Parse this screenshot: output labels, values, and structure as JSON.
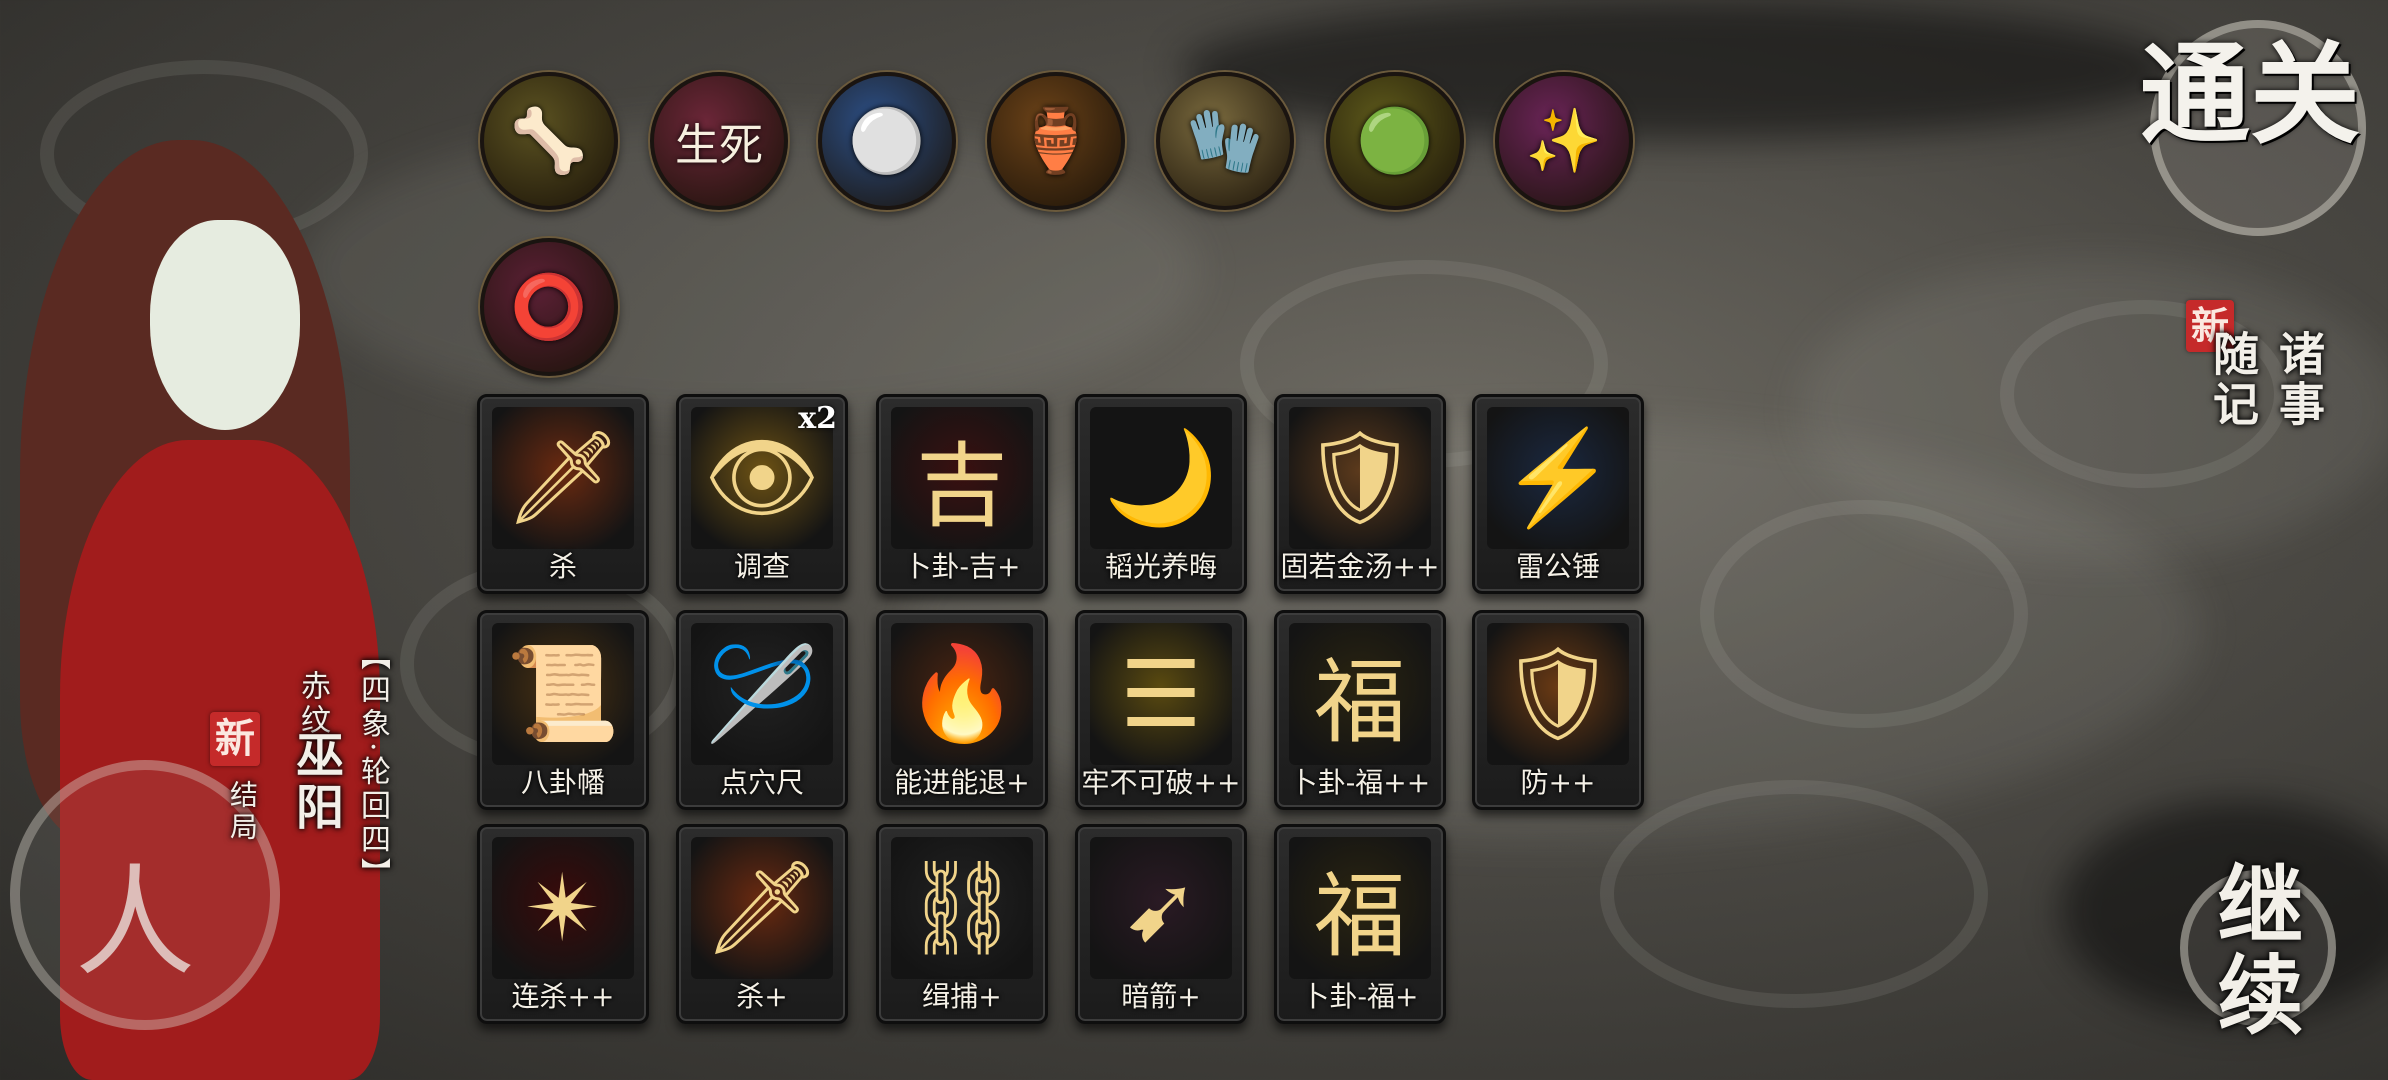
{
  "relics": [
    {
      "icon": "horn-icon",
      "glyph": "🦴",
      "bg": "#5b5221"
    },
    {
      "icon": "brush-life-death-icon",
      "glyph": "生死",
      "bg": "#6b2638"
    },
    {
      "icon": "pearls-icon",
      "glyph": "⚪",
      "bg": "#2c4f86"
    },
    {
      "icon": "gold-cup-icon",
      "glyph": "🏺",
      "bg": "#6b4218"
    },
    {
      "icon": "bracer-icon",
      "glyph": "🧤",
      "bg": "#7a6a3e"
    },
    {
      "icon": "green-jade-icon",
      "glyph": "🟢",
      "bg": "#5e5a1b"
    },
    {
      "icon": "golden-scepter-icon",
      "glyph": "✨",
      "bg": "#6a2457"
    },
    {
      "icon": "rainbow-ring-icon",
      "glyph": "⭕",
      "bg": "#5b2035"
    }
  ],
  "cards": [
    {
      "label": "杀",
      "icon": "blade-slash-icon",
      "glyph": "🗡",
      "tint": "#6b2a10"
    },
    {
      "label": "调查",
      "icon": "golden-eye-icon",
      "glyph": "👁",
      "tint": "#6d5214",
      "count": "x2"
    },
    {
      "label": "卜卦-吉+",
      "icon": "red-calligraphy-icon",
      "glyph": "吉",
      "tint": "#3a1010"
    },
    {
      "label": "韬光养晦",
      "icon": "crescent-moon-icon",
      "glyph": "🌙",
      "tint": "#141414"
    },
    {
      "label": "固若金汤++",
      "icon": "twin-shields-icon",
      "glyph": "🛡",
      "tint": "#5c3a1c"
    },
    {
      "label": "雷公锤",
      "icon": "thunder-hammer-icon",
      "glyph": "⚡",
      "tint": "#1a2840"
    },
    {
      "label": "八卦幡",
      "icon": "bagua-banner-icon",
      "glyph": "📜",
      "tint": "#4a3212"
    },
    {
      "label": "点穴尺",
      "icon": "needle-ruler-icon",
      "glyph": "🪡",
      "tint": "#222"
    },
    {
      "label": "能进能退+",
      "icon": "fire-shield-icon",
      "glyph": "🔥",
      "tint": "#4a2410"
    },
    {
      "label": "牢不可破++",
      "icon": "golden-trigram-icon",
      "glyph": "☰",
      "tint": "#5a4a10"
    },
    {
      "label": "卜卦-福++",
      "icon": "fortune-calligraphy-icon",
      "glyph": "福",
      "tint": "#2a2410"
    },
    {
      "label": "防++",
      "icon": "glowing-shield-icon",
      "glyph": "🛡",
      "tint": "#6a3a14"
    },
    {
      "label": "连杀++",
      "icon": "red-star-burst-icon",
      "glyph": "✴",
      "tint": "#3a0a0a"
    },
    {
      "label": "杀+",
      "icon": "blade-slash-icon",
      "glyph": "🗡",
      "tint": "#6b2a10"
    },
    {
      "label": "缉捕+",
      "icon": "chains-icon",
      "glyph": "⛓",
      "tint": "#222"
    },
    {
      "label": "暗箭+",
      "icon": "dark-arrow-icon",
      "glyph": "➹",
      "tint": "#2a1a24"
    },
    {
      "label": "卜卦-福+",
      "icon": "fortune-calligraphy-icon",
      "glyph": "福",
      "tint": "#2a2410"
    }
  ],
  "character": {
    "title_bracket": "【四象·轮回四】",
    "name": "巫阳",
    "name_label": "赤纹",
    "new_badge": "新",
    "new_text": "结局",
    "seal_glyph": "人"
  },
  "right_panel": {
    "tongguan": "通关",
    "new_badge": "新",
    "notes": "诸事随记",
    "continue": "继续"
  }
}
